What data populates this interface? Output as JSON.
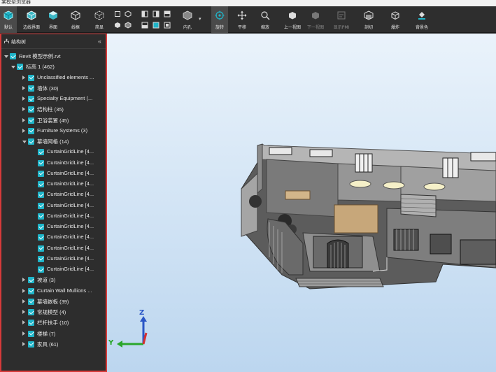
{
  "window": {
    "title": "某模型浏览器"
  },
  "toolbar": {
    "items": [
      {
        "label": "默认",
        "icon": "cube-default-icon"
      },
      {
        "label": "边线界面",
        "icon": "cube-edge-icon"
      },
      {
        "label": "界面",
        "icon": "cube-face-icon"
      },
      {
        "label": "线框",
        "icon": "cube-wireframe-icon"
      },
      {
        "label": "简显",
        "icon": "cube-simple-icon"
      },
      {
        "label": "剖视",
        "icon": "section-icon"
      },
      {
        "label": "内孔",
        "icon": "inner-icon"
      },
      {
        "label": "旋转",
        "icon": "rotate-icon"
      },
      {
        "label": "平移",
        "icon": "pan-icon"
      },
      {
        "label": "缩放",
        "icon": "zoom-icon"
      },
      {
        "label": "上一视图",
        "icon": "prev-view-icon"
      },
      {
        "label": "下一视图",
        "icon": "next-view-icon"
      },
      {
        "label": "显示PMI",
        "icon": "pmi-icon"
      },
      {
        "label": "剖切",
        "icon": "cut-icon"
      },
      {
        "label": "爆炸",
        "icon": "explode-icon"
      },
      {
        "label": "背景色",
        "icon": "background-color-icon"
      }
    ]
  },
  "panel": {
    "title": "结构树",
    "collapse": "«",
    "tree": [
      {
        "label": "Revit 模型示例.rvt",
        "level": 0,
        "expanded": true
      },
      {
        "label": "标高 1 (462)",
        "level": 1,
        "expanded": true
      },
      {
        "label": "Unclassified elements ...",
        "level": 2,
        "expanded": false
      },
      {
        "label": "墙体 (30)",
        "level": 2,
        "expanded": false
      },
      {
        "label": "Specialty Equipment (...",
        "level": 2,
        "expanded": false
      },
      {
        "label": "结构柱 (35)",
        "level": 2,
        "expanded": false
      },
      {
        "label": "卫浴装置 (45)",
        "level": 2,
        "expanded": false
      },
      {
        "label": "Furniture Systems (3)",
        "level": 2,
        "expanded": false
      },
      {
        "label": "幕墙网格 (14)",
        "level": 2,
        "expanded": true
      },
      {
        "label": "CurtainGridLine [4...",
        "level": 3
      },
      {
        "label": "CurtainGridLine [4...",
        "level": 3
      },
      {
        "label": "CurtainGridLine [4...",
        "level": 3
      },
      {
        "label": "CurtainGridLine [4...",
        "level": 3
      },
      {
        "label": "CurtainGridLine [4...",
        "level": 3
      },
      {
        "label": "CurtainGridLine [4...",
        "level": 3
      },
      {
        "label": "CurtainGridLine [4...",
        "level": 3
      },
      {
        "label": "CurtainGridLine [4...",
        "level": 3
      },
      {
        "label": "CurtainGridLine [4...",
        "level": 3
      },
      {
        "label": "CurtainGridLine [4...",
        "level": 3
      },
      {
        "label": "CurtainGridLine [4...",
        "level": 3
      },
      {
        "label": "CurtainGridLine [4...",
        "level": 3
      },
      {
        "label": "坡道 (3)",
        "level": 2,
        "expanded": false
      },
      {
        "label": "Curtain Wall Mullions ...",
        "level": 2,
        "expanded": false
      },
      {
        "label": "幕墙嵌板 (39)",
        "level": 2,
        "expanded": false
      },
      {
        "label": "常规模型 (4)",
        "level": 2,
        "expanded": false
      },
      {
        "label": "栏杆扶手 (10)",
        "level": 2,
        "expanded": false
      },
      {
        "label": "楼梯 (7)",
        "level": 2,
        "expanded": false
      },
      {
        "label": "家具 (61)",
        "level": 2,
        "expanded": false
      }
    ]
  },
  "viewport": {
    "axes": {
      "z": "Z",
      "y": "Y"
    },
    "colors": {
      "check": "#1fb5c9",
      "panel_border": "#d63a3a",
      "axis_z": "#2a56c6",
      "axis_y": "#2aa62a",
      "axis_x": "#d63030"
    }
  }
}
